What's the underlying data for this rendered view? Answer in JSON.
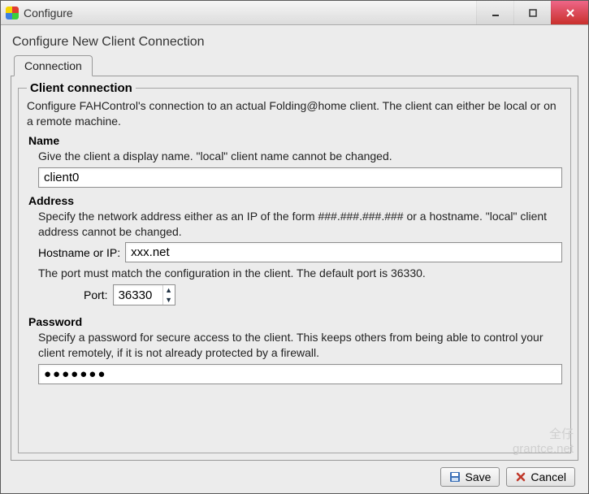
{
  "window": {
    "title": "Configure"
  },
  "subtitle": "Configure New Client Connection",
  "tab": {
    "label": "Connection"
  },
  "group": {
    "legend": "Client connection",
    "description": "Configure FAHControl's connection to an actual Folding@home client.  The client can either be local or on a remote machine."
  },
  "name": {
    "title": "Name",
    "description": "Give the client a display name.  \"local\" client name cannot be changed.",
    "value": "client0"
  },
  "address": {
    "title": "Address",
    "description": "Specify the network address either as an IP of the form ###.###.###.### or a hostname.  \"local\" client address cannot be changed.",
    "hostname_label": "Hostname or IP:",
    "hostname_value": "xxx.net",
    "port_description": "The port must match the configuration in the client.  The default port is 36330.",
    "port_label": "Port:",
    "port_value": "36330"
  },
  "password": {
    "title": "Password",
    "description": "Specify a password for secure access to the client.  This keeps others from being able to control your client remotely, if it is not already protected by a firewall.",
    "value": "●●●●●●●"
  },
  "buttons": {
    "save": "Save",
    "cancel": "Cancel"
  },
  "watermark": {
    "line1": "全仔",
    "line2": "grantce.net"
  }
}
